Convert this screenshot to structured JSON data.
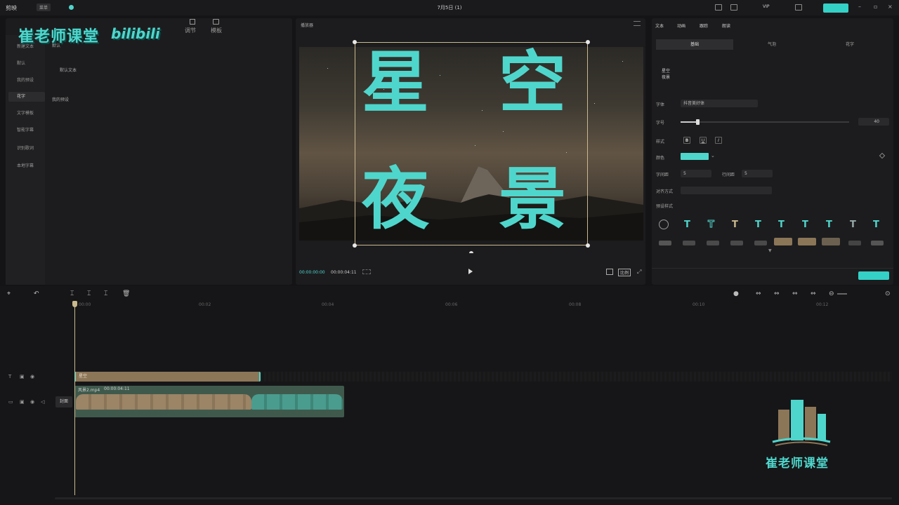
{
  "titlebar": {
    "app_name": "剪映",
    "menu_label": "菜单",
    "project_title": "7月5日 (1)",
    "vip_label": "VIP",
    "export_label": ""
  },
  "watermark": {
    "text": "崔老师课堂",
    "bili": "bilibili"
  },
  "left_panel": {
    "tabs": [
      "调节",
      "模板"
    ],
    "sidebar": [
      "新建文本",
      "默认",
      "我的预设",
      "花字",
      "文字模板",
      "智能字幕",
      "识别歌词",
      "本地字幕"
    ],
    "active_sidebar": "花字",
    "section_default": "默认",
    "default_text_item": "默认文本",
    "my_presets": "我的预设"
  },
  "player": {
    "title": "播放器",
    "overlay_chars": [
      "星",
      "空",
      "夜",
      "景"
    ],
    "current_time": "00:00:00:00",
    "total_time": "00:00:04:11",
    "ratio_label": "比例"
  },
  "right_panel": {
    "tabs": [
      "文本",
      "动画",
      "跟踪",
      "朗读"
    ],
    "subtabs": [
      "基础",
      "气泡",
      "花字"
    ],
    "text_content_line1": "星空",
    "text_content_line2": "夜景",
    "font_label": "字体",
    "font_value": "抖音美好体",
    "size_label": "字号",
    "size_value": "40",
    "size_level": 0.1,
    "style_label": "样式",
    "style_buttons": [
      "B",
      "U",
      "I"
    ],
    "color_label": "颜色",
    "color_value": "#4fd6cc",
    "char_spacing_label": "字间距",
    "char_spacing_value": "5",
    "line_spacing_label": "行间距",
    "line_spacing_value": "5",
    "align_label": "对齐方式",
    "preset_label": "预设样式"
  },
  "timeline": {
    "ruler": [
      "00:00",
      "00:02",
      "00:04",
      "00:06",
      "00:08",
      "00:10",
      "00:12"
    ],
    "text_clip_label": "星空",
    "video_clip_name": "风景2.mp4",
    "video_clip_duration": "00:00:04:11",
    "cover_label": "封面"
  },
  "branding": {
    "logo_text": "崔老师课堂"
  }
}
